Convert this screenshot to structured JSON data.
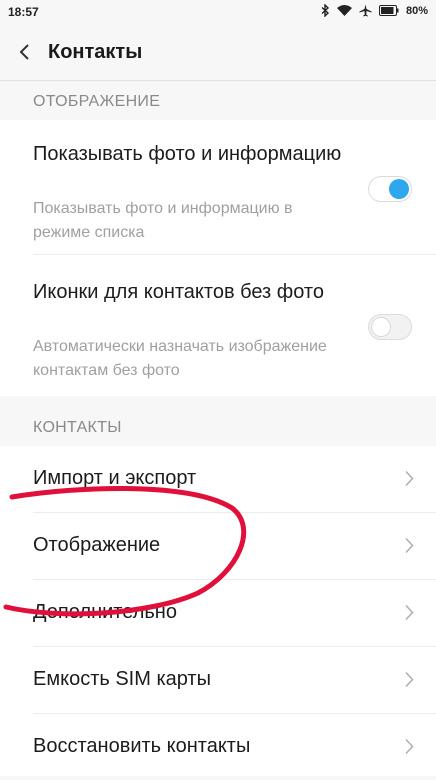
{
  "status_bar": {
    "time": "18:57",
    "battery": "80%",
    "icons": [
      "bluetooth-icon",
      "wifi-icon",
      "airplane-icon",
      "battery-icon"
    ]
  },
  "header": {
    "title": "Контакты",
    "back_icon": "chevron-left-icon"
  },
  "display_section": {
    "header": "ОТОБРАЖЕНИЕ",
    "items": [
      {
        "title": "Показывать фото и информацию",
        "description": "Показывать фото и информацию в режиме списка",
        "enabled": true
      },
      {
        "title": "Иконки для контактов без фото",
        "description": "Автоматически назначать изображение контактам без фото",
        "enabled": false
      }
    ]
  },
  "contacts_section": {
    "header": "КОНТАКТЫ",
    "items": [
      {
        "label": "Импорт и экспорт"
      },
      {
        "label": "Отображение"
      },
      {
        "label": "Дополнительно"
      },
      {
        "label": "Емкость SIM карты"
      },
      {
        "label": "Восстановить контакты"
      }
    ]
  },
  "colors": {
    "accent": "#2ea7ef",
    "annotation": "#e0103a",
    "background": "#f7f7f7"
  }
}
